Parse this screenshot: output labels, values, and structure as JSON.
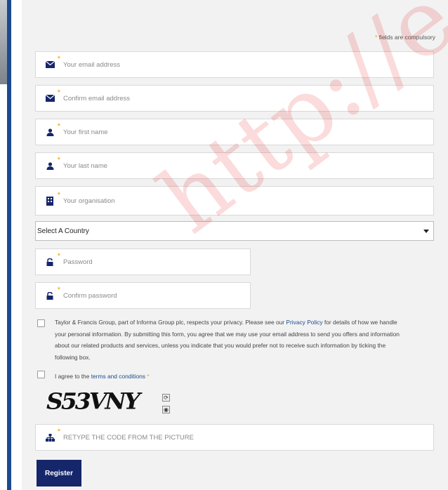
{
  "compulsory_note": {
    "star": "*",
    "text": "fields are compulsory"
  },
  "fields": {
    "email": {
      "placeholder": "Your email address",
      "icon": "envelope-icon"
    },
    "confirm_email": {
      "placeholder": "Confirm email address",
      "icon": "envelope-icon"
    },
    "first_name": {
      "placeholder": "Your first name",
      "icon": "user-icon"
    },
    "last_name": {
      "placeholder": "Your last name",
      "icon": "user-icon"
    },
    "organisation": {
      "placeholder": "Your organisation",
      "icon": "building-icon"
    },
    "password": {
      "placeholder": "Password",
      "icon": "lock-icon"
    },
    "confirm_password": {
      "placeholder": "Confirm password",
      "icon": "lock-icon"
    },
    "captcha_code": {
      "placeholder": "RETYPE THE CODE FROM THE PICTURE",
      "icon": "sitemap-icon"
    }
  },
  "required_star": "*",
  "country_select": {
    "selected": "Select A Country"
  },
  "privacy": {
    "text_before": "Taylor & Francis Group, part of Informa Group plc, respects your privacy. Please see our ",
    "link": "Privacy Policy",
    "text_after": " for details of how we handle your personal information. By submitting this form, you agree that we may use your email address to send you offers and information about our related products and services, unless you indicate that you would prefer not to receive such information by ticking the following box."
  },
  "terms": {
    "text_before": "I agree to the ",
    "link": "terms and conditions",
    "star": "*"
  },
  "captcha": {
    "text": "S53VNY"
  },
  "register_label": "Register",
  "watermark": "http://en",
  "colors": {
    "accent": "#15266b",
    "required": "#f0a000",
    "link": "#1b4a8f"
  }
}
